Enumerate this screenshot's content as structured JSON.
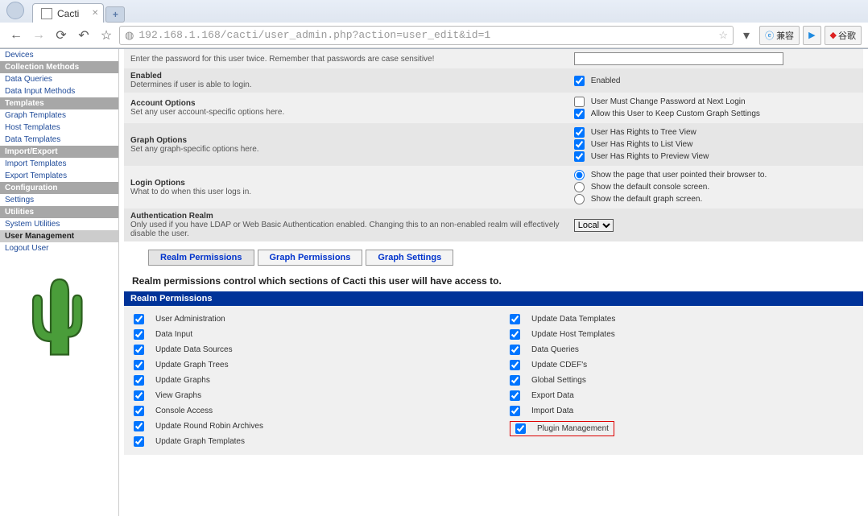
{
  "browser": {
    "tab_title": "Cacti",
    "url": "192.168.1.168/cacti/user_admin.php?action=user_edit&id=1",
    "compat_label": "兼容",
    "google_label": "谷歌"
  },
  "sidebar": {
    "items": [
      {
        "type": "link",
        "label": "Devices"
      },
      {
        "type": "hdr",
        "label": "Collection Methods"
      },
      {
        "type": "link",
        "label": "Data Queries"
      },
      {
        "type": "link",
        "label": "Data Input Methods"
      },
      {
        "type": "hdr",
        "label": "Templates"
      },
      {
        "type": "link",
        "label": "Graph Templates"
      },
      {
        "type": "link",
        "label": "Host Templates"
      },
      {
        "type": "link",
        "label": "Data Templates"
      },
      {
        "type": "hdr",
        "label": "Import/Export"
      },
      {
        "type": "link",
        "label": "Import Templates"
      },
      {
        "type": "link",
        "label": "Export Templates"
      },
      {
        "type": "hdr",
        "label": "Configuration"
      },
      {
        "type": "link",
        "label": "Settings"
      },
      {
        "type": "hdr",
        "label": "Utilities"
      },
      {
        "type": "link",
        "label": "System Utilities"
      },
      {
        "type": "active",
        "label": "User Management"
      },
      {
        "type": "link",
        "label": "Logout User"
      }
    ]
  },
  "form": {
    "password_desc": "Enter the password for this user twice. Remember that passwords are case sensitive!",
    "enabled_label": "Enabled",
    "enabled_desc": "Determines if user is able to login.",
    "enabled_cb": "Enabled",
    "account_label": "Account Options",
    "account_desc": "Set any user account-specific options here.",
    "cb_change_pw": "User Must Change Password at Next Login",
    "cb_keep_graph": "Allow this User to Keep Custom Graph Settings",
    "graph_label": "Graph Options",
    "graph_desc": "Set any graph-specific options here.",
    "cb_tree": "User Has Rights to Tree View",
    "cb_list": "User Has Rights to List View",
    "cb_preview": "User Has Rights to Preview View",
    "login_label": "Login Options",
    "login_desc": "What to do when this user logs in.",
    "rb1": "Show the page that user pointed their browser to.",
    "rb2": "Show the default console screen.",
    "rb3": "Show the default graph screen.",
    "realm_label": "Authentication Realm",
    "realm_desc": "Only used if you have LDAP or Web Basic Authentication enabled. Changing this to an non-enabled realm will effectively disable the user.",
    "realm_value": "Local"
  },
  "tabs": {
    "realm": "Realm Permissions",
    "graph": "Graph Permissions",
    "settings": "Graph Settings"
  },
  "desc_line": "Realm permissions control which sections of Cacti this user will have access to.",
  "perm_header": "Realm Permissions",
  "perms_left": [
    "User Administration",
    "Data Input",
    "Update Data Sources",
    "Update Graph Trees",
    "Update Graphs",
    "View Graphs",
    "Console Access",
    "Update Round Robin Archives",
    "Update Graph Templates"
  ],
  "perms_right": [
    "Update Data Templates",
    "Update Host Templates",
    "Data Queries",
    "Update CDEF's",
    "Global Settings",
    "Export Data",
    "Import Data",
    "Plugin Management"
  ]
}
